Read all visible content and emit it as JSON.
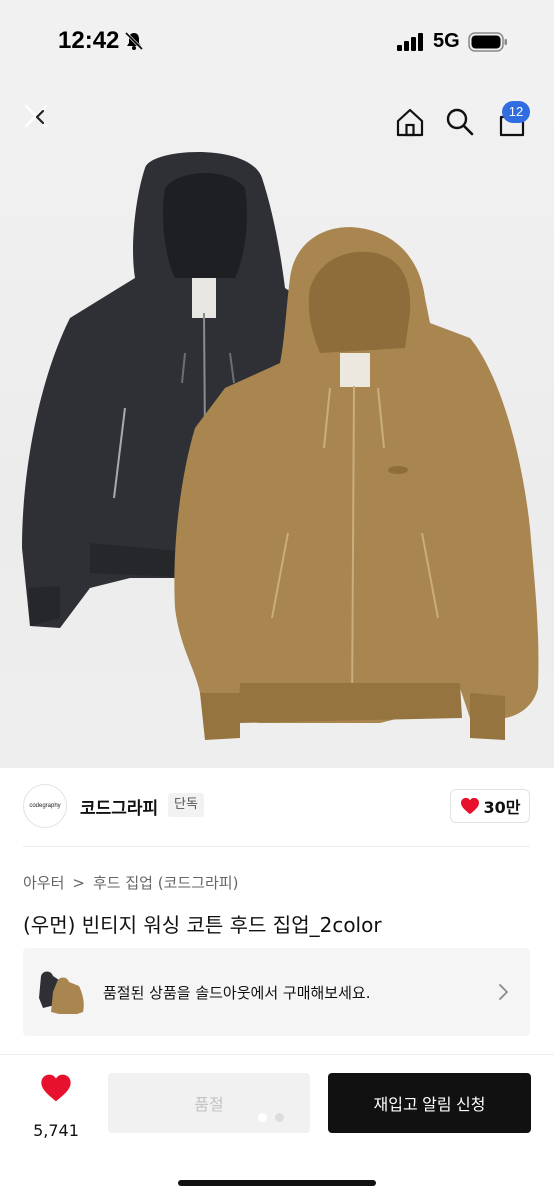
{
  "status_bar": {
    "time": "12:42",
    "network": "5G"
  },
  "header": {
    "cart_count": "12"
  },
  "brand": {
    "logo_text": "codegraphy",
    "name": "코드그라피",
    "badge": "단독",
    "likes": "30만"
  },
  "breadcrumb": {
    "category": "아우터",
    "separator": ">",
    "subcategory": "후드 집업 (코드그라피)"
  },
  "product": {
    "title": "(우먼) 빈티지 워싱 코튼 후드 집업_2color"
  },
  "soldout_banner": {
    "text": "품절된 상품을 솔드아웃에서 구매해보세요."
  },
  "bottom_bar": {
    "wish_count": "5,741",
    "soldout_label": "품절",
    "restock_label": "재입고 알림 신청"
  },
  "colors": {
    "accent_red": "#e8112d",
    "badge_blue": "#2f6de1",
    "jacket_black": "#2e3035",
    "jacket_tan": "#a98650"
  },
  "icons": [
    "bell-off-icon",
    "signal-icon",
    "battery-icon",
    "close-icon",
    "home-icon",
    "search-icon",
    "cart-icon",
    "heart-icon",
    "chevron-right-icon"
  ]
}
